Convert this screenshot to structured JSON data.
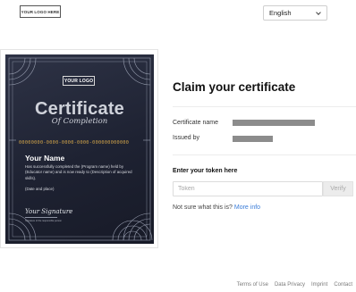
{
  "header": {
    "logo_text": "YOUR LOGO HERE",
    "language": "English"
  },
  "certificate": {
    "logo_text": "YOUR LOGO",
    "title": "Certificate",
    "subtitle": "Of Completion",
    "id": "00000000-0000-0000-0000-000000000000",
    "name": "Your Name",
    "description": "Has successfully completed the (Program name) held by (Educator name) and is now ready to (Description of acquired skills).",
    "date_place": "(Date and place)",
    "signature": "Your Signature",
    "signature_caption": "Signature of the responsible person",
    "colors": {
      "background": "#1e2232",
      "accent": "#d4a64a",
      "ornament": "#9aa0b2"
    }
  },
  "claim": {
    "heading": "Claim your certificate",
    "certificate_name_label": "Certificate name",
    "issued_by_label": "Issued by",
    "token_heading": "Enter your token here",
    "token_placeholder": "Token",
    "verify_label": "Verify",
    "help_text": "Not sure what this is?",
    "help_link": "More info"
  },
  "footer": {
    "links": [
      "Terms of Use",
      "Data Privacy",
      "Imprint",
      "Contact"
    ]
  }
}
